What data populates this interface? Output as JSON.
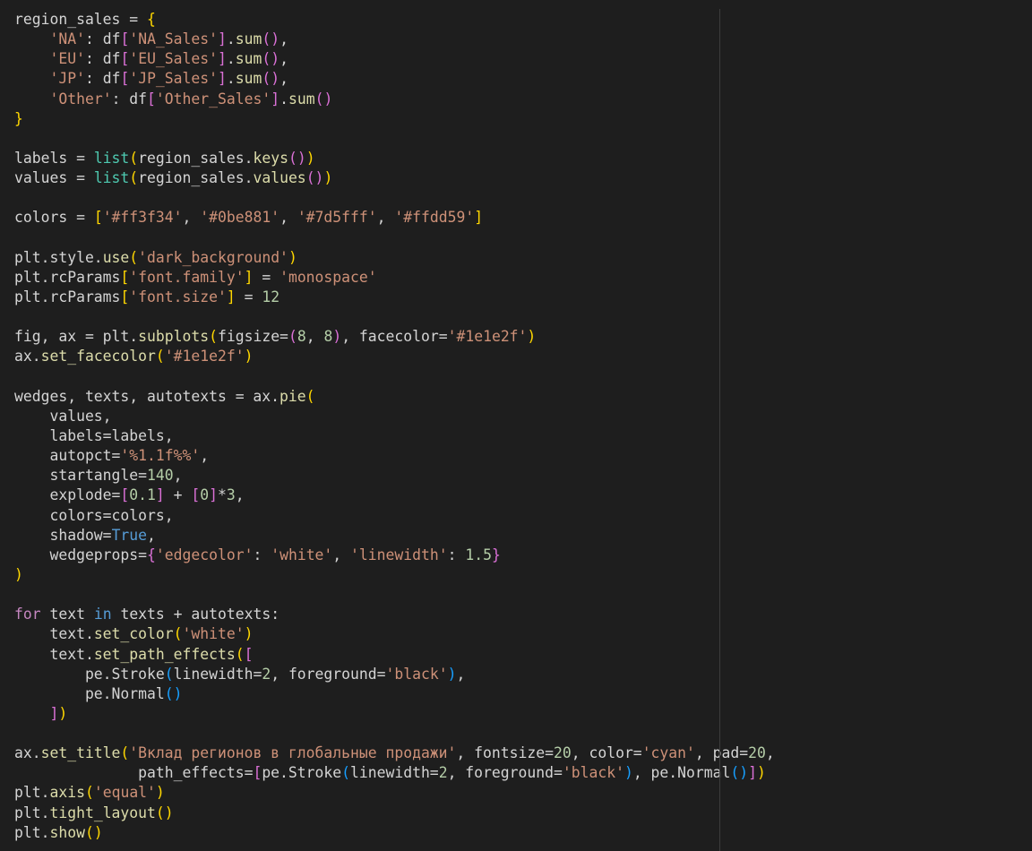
{
  "editor": {
    "lines": [
      [
        [
          "p",
          "region_sales = "
        ],
        [
          "b1",
          "{"
        ]
      ],
      [
        [
          "p",
          "    "
        ],
        [
          "s",
          "'NA'"
        ],
        [
          "p",
          ": df"
        ],
        [
          "b2",
          "["
        ],
        [
          "s",
          "'NA_Sales'"
        ],
        [
          "b2",
          "]"
        ],
        [
          "p",
          "."
        ],
        [
          "f",
          "sum"
        ],
        [
          "b2",
          "()"
        ],
        [
          "p",
          ","
        ]
      ],
      [
        [
          "p",
          "    "
        ],
        [
          "s",
          "'EU'"
        ],
        [
          "p",
          ": df"
        ],
        [
          "b2",
          "["
        ],
        [
          "s",
          "'EU_Sales'"
        ],
        [
          "b2",
          "]"
        ],
        [
          "p",
          "."
        ],
        [
          "f",
          "sum"
        ],
        [
          "b2",
          "()"
        ],
        [
          "p",
          ","
        ]
      ],
      [
        [
          "p",
          "    "
        ],
        [
          "s",
          "'JP'"
        ],
        [
          "p",
          ": df"
        ],
        [
          "b2",
          "["
        ],
        [
          "s",
          "'JP_Sales'"
        ],
        [
          "b2",
          "]"
        ],
        [
          "p",
          "."
        ],
        [
          "f",
          "sum"
        ],
        [
          "b2",
          "()"
        ],
        [
          "p",
          ","
        ]
      ],
      [
        [
          "p",
          "    "
        ],
        [
          "s",
          "'Other'"
        ],
        [
          "p",
          ": df"
        ],
        [
          "b2",
          "["
        ],
        [
          "s",
          "'Other_Sales'"
        ],
        [
          "b2",
          "]"
        ],
        [
          "p",
          "."
        ],
        [
          "f",
          "sum"
        ],
        [
          "b2",
          "()"
        ]
      ],
      [
        [
          "b1",
          "}"
        ]
      ],
      [],
      [
        [
          "p",
          "labels = "
        ],
        [
          "t",
          "list"
        ],
        [
          "b1",
          "("
        ],
        [
          "p",
          "region_sales."
        ],
        [
          "f",
          "keys"
        ],
        [
          "b2",
          "()"
        ],
        [
          "b1",
          ")"
        ]
      ],
      [
        [
          "p",
          "values = "
        ],
        [
          "t",
          "list"
        ],
        [
          "b1",
          "("
        ],
        [
          "p",
          "region_sales."
        ],
        [
          "f",
          "values"
        ],
        [
          "b2",
          "()"
        ],
        [
          "b1",
          ")"
        ]
      ],
      [],
      [
        [
          "p",
          "colors = "
        ],
        [
          "b1",
          "["
        ],
        [
          "s",
          "'#ff3f34'"
        ],
        [
          "p",
          ", "
        ],
        [
          "s",
          "'#0be881'"
        ],
        [
          "p",
          ", "
        ],
        [
          "s",
          "'#7d5fff'"
        ],
        [
          "p",
          ", "
        ],
        [
          "s",
          "'#ffdd59'"
        ],
        [
          "b1",
          "]"
        ]
      ],
      [],
      [
        [
          "p",
          "plt.style."
        ],
        [
          "f",
          "use"
        ],
        [
          "b1",
          "("
        ],
        [
          "s",
          "'dark_background'"
        ],
        [
          "b1",
          ")"
        ]
      ],
      [
        [
          "p",
          "plt.rcParams"
        ],
        [
          "b1",
          "["
        ],
        [
          "s",
          "'font.family'"
        ],
        [
          "b1",
          "]"
        ],
        [
          "p",
          " = "
        ],
        [
          "s",
          "'monospace'"
        ]
      ],
      [
        [
          "p",
          "plt.rcParams"
        ],
        [
          "b1",
          "["
        ],
        [
          "s",
          "'font.size'"
        ],
        [
          "b1",
          "]"
        ],
        [
          "p",
          " = "
        ],
        [
          "n",
          "12"
        ]
      ],
      [],
      [
        [
          "p",
          "fig, ax = plt."
        ],
        [
          "f",
          "subplots"
        ],
        [
          "b1",
          "("
        ],
        [
          "p",
          "figsize="
        ],
        [
          "b2",
          "("
        ],
        [
          "n",
          "8"
        ],
        [
          "p",
          ", "
        ],
        [
          "n",
          "8"
        ],
        [
          "b2",
          ")"
        ],
        [
          "p",
          ", facecolor="
        ],
        [
          "s",
          "'#1e1e2f'"
        ],
        [
          "b1",
          ")"
        ]
      ],
      [
        [
          "p",
          "ax."
        ],
        [
          "f",
          "set_facecolor"
        ],
        [
          "b1",
          "("
        ],
        [
          "s",
          "'#1e1e2f'"
        ],
        [
          "b1",
          ")"
        ]
      ],
      [],
      [
        [
          "p",
          "wedges, texts, autotexts = ax."
        ],
        [
          "f",
          "pie"
        ],
        [
          "b1",
          "("
        ]
      ],
      [
        [
          "p",
          "    values,"
        ]
      ],
      [
        [
          "p",
          "    labels=labels,"
        ]
      ],
      [
        [
          "p",
          "    autopct="
        ],
        [
          "s",
          "'%1.1f%%'"
        ],
        [
          "p",
          ","
        ]
      ],
      [
        [
          "p",
          "    startangle="
        ],
        [
          "n",
          "140"
        ],
        [
          "p",
          ","
        ]
      ],
      [
        [
          "p",
          "    explode="
        ],
        [
          "b2",
          "["
        ],
        [
          "n",
          "0.1"
        ],
        [
          "b2",
          "]"
        ],
        [
          "p",
          " + "
        ],
        [
          "b2",
          "["
        ],
        [
          "n",
          "0"
        ],
        [
          "b2",
          "]"
        ],
        [
          "p",
          "*"
        ],
        [
          "n",
          "3"
        ],
        [
          "p",
          ","
        ]
      ],
      [
        [
          "p",
          "    colors=colors,"
        ]
      ],
      [
        [
          "p",
          "    shadow="
        ],
        [
          "c",
          "True"
        ],
        [
          "p",
          ","
        ]
      ],
      [
        [
          "p",
          "    wedgeprops="
        ],
        [
          "b2",
          "{"
        ],
        [
          "s",
          "'edgecolor'"
        ],
        [
          "p",
          ": "
        ],
        [
          "s",
          "'white'"
        ],
        [
          "p",
          ", "
        ],
        [
          "s",
          "'linewidth'"
        ],
        [
          "p",
          ": "
        ],
        [
          "n",
          "1.5"
        ],
        [
          "b2",
          "}"
        ]
      ],
      [
        [
          "b1",
          ")"
        ]
      ],
      [],
      [
        [
          "k",
          "for"
        ],
        [
          "p",
          " text "
        ],
        [
          "c",
          "in"
        ],
        [
          "p",
          " texts + autotexts:"
        ]
      ],
      [
        [
          "p",
          "    text."
        ],
        [
          "f",
          "set_color"
        ],
        [
          "b1",
          "("
        ],
        [
          "s",
          "'white'"
        ],
        [
          "b1",
          ")"
        ]
      ],
      [
        [
          "p",
          "    text."
        ],
        [
          "f",
          "set_path_effects"
        ],
        [
          "b1",
          "("
        ],
        [
          "b2",
          "["
        ]
      ],
      [
        [
          "p",
          "        pe.Stroke"
        ],
        [
          "b3",
          "("
        ],
        [
          "p",
          "linewidth="
        ],
        [
          "n",
          "2"
        ],
        [
          "p",
          ", foreground="
        ],
        [
          "s",
          "'black'"
        ],
        [
          "b3",
          ")"
        ],
        [
          "p",
          ","
        ]
      ],
      [
        [
          "p",
          "        pe.Normal"
        ],
        [
          "b3",
          "()"
        ]
      ],
      [
        [
          "p",
          "    "
        ],
        [
          "b2",
          "]"
        ],
        [
          "b1",
          ")"
        ]
      ],
      [],
      [
        [
          "p",
          "ax."
        ],
        [
          "f",
          "set_title"
        ],
        [
          "b1",
          "("
        ],
        [
          "s",
          "'Вклад регионов в глобальные продажи'"
        ],
        [
          "p",
          ", fontsize="
        ],
        [
          "n",
          "20"
        ],
        [
          "p",
          ", color="
        ],
        [
          "s",
          "'cyan'"
        ],
        [
          "p",
          ", pad="
        ],
        [
          "n",
          "20"
        ],
        [
          "p",
          ","
        ]
      ],
      [
        [
          "p",
          "              path_effects="
        ],
        [
          "b2",
          "["
        ],
        [
          "p",
          "pe.Stroke"
        ],
        [
          "b3",
          "("
        ],
        [
          "p",
          "linewidth="
        ],
        [
          "n",
          "2"
        ],
        [
          "p",
          ", foreground="
        ],
        [
          "s",
          "'black'"
        ],
        [
          "b3",
          ")"
        ],
        [
          "p",
          ", pe.Normal"
        ],
        [
          "b3",
          "()"
        ],
        [
          "b2",
          "]"
        ],
        [
          "b1",
          ")"
        ]
      ],
      [
        [
          "p",
          "plt."
        ],
        [
          "f",
          "axis"
        ],
        [
          "b1",
          "("
        ],
        [
          "s",
          "'equal'"
        ],
        [
          "b1",
          ")"
        ]
      ],
      [
        [
          "p",
          "plt."
        ],
        [
          "f",
          "tight_layout"
        ],
        [
          "b1",
          "()"
        ]
      ],
      [
        [
          "p",
          "plt."
        ],
        [
          "f",
          "show"
        ],
        [
          "b1",
          "()"
        ]
      ]
    ]
  }
}
